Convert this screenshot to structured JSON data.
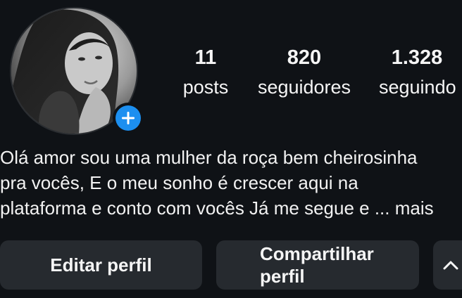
{
  "profile": {
    "stats": [
      {
        "key": "posts",
        "count": "11",
        "label": "posts"
      },
      {
        "key": "followers",
        "count": "820",
        "label": "seguidores"
      },
      {
        "key": "following",
        "count": "1.328",
        "label": "seguindo"
      }
    ],
    "bio": {
      "lines": [
        "Olá amor sou uma mulher da roça bem cheirosinha",
        "pra vocês, E o meu sonho é crescer aqui na",
        "plataforma e conto com vocês Já me segue e ..."
      ],
      "more_label": "mais"
    },
    "avatar": {
      "icon": "profile-photo",
      "badge_icon": "plus-icon"
    }
  },
  "actions": {
    "edit_label": "Editar perfil",
    "share_label_line1": "Compartilhar",
    "share_label_line2": "perfil",
    "expand_icon": "chevron-up-icon"
  },
  "colors": {
    "background": "#0f1216",
    "button_bg": "#262a2f",
    "accent": "#1c8ff0",
    "text": "#f5f5f5"
  }
}
